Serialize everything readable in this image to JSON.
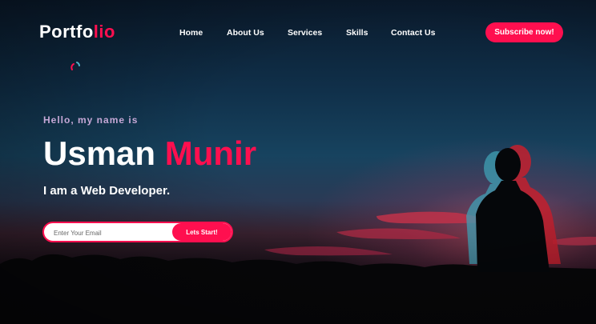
{
  "logo": {
    "text_main": "Portfo",
    "text_accent": "lio"
  },
  "nav": {
    "items": [
      {
        "label": "Home"
      },
      {
        "label": "About Us"
      },
      {
        "label": "Services"
      },
      {
        "label": "Skills"
      },
      {
        "label": "Contact Us"
      }
    ]
  },
  "subscribe_label": "Subscribe now!",
  "hero": {
    "greeting": "Hello, my name is",
    "first_name": "Usman",
    "last_name": "Munir",
    "role": "I am a Web Developer.",
    "email_placeholder": "Enter Your Email",
    "start_label": "Lets Start!"
  },
  "colors": {
    "accent": "#ff0f4f",
    "greeting": "#c6a8d6",
    "text": "#ffffff"
  }
}
